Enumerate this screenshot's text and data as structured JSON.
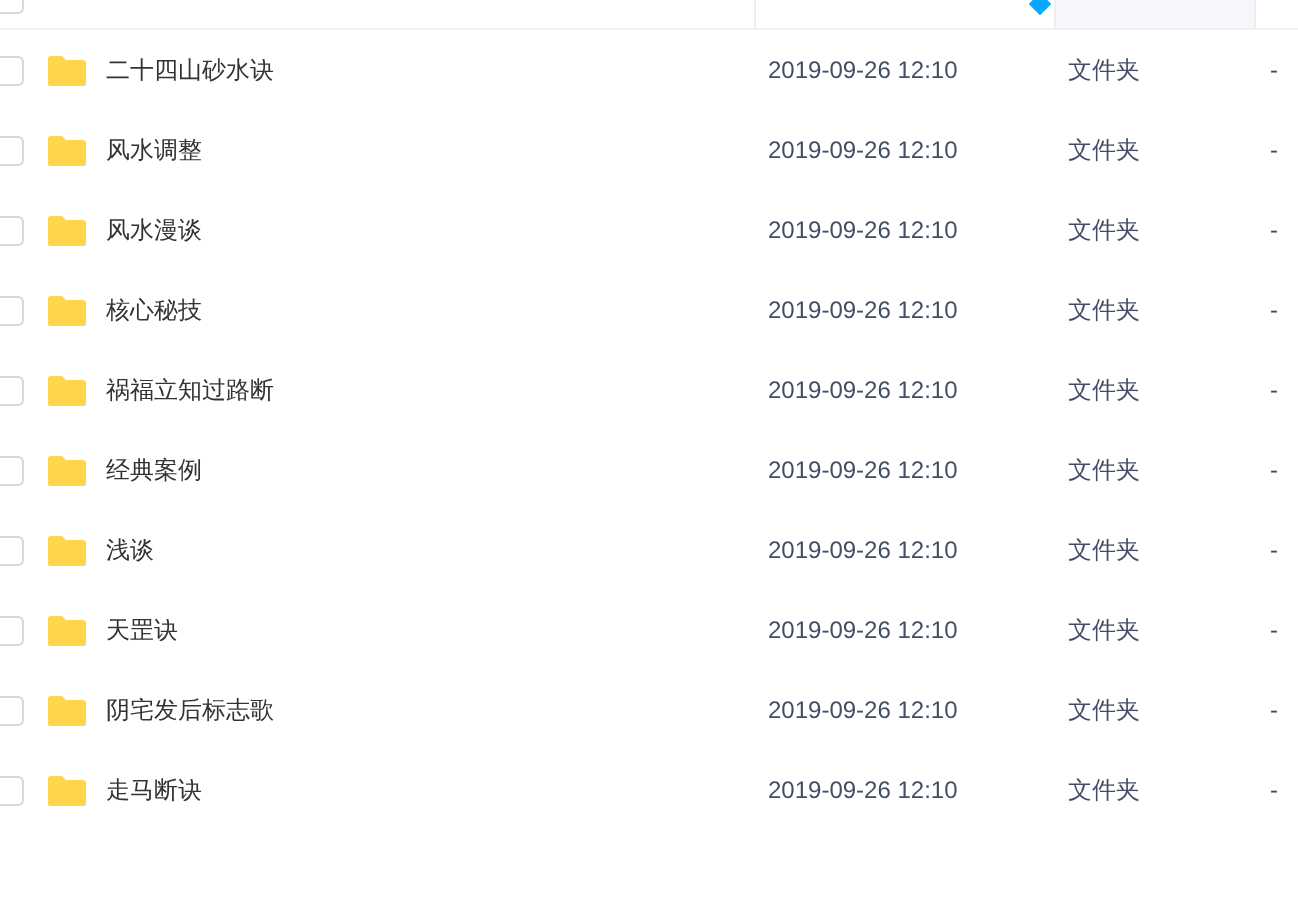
{
  "header": {
    "checked": false
  },
  "columns": [
    {
      "sorted": false
    },
    {
      "sorted": true
    },
    {
      "sorted": false
    },
    {
      "sorted": false
    }
  ],
  "rows": [
    {
      "name": "二十四山砂水诀",
      "modified": "2019-09-26 12:10",
      "type": "文件夹",
      "size": "-",
      "checked": false
    },
    {
      "name": "风水调整",
      "modified": "2019-09-26 12:10",
      "type": "文件夹",
      "size": "-",
      "checked": false
    },
    {
      "name": "风水漫谈",
      "modified": "2019-09-26 12:10",
      "type": "文件夹",
      "size": "-",
      "checked": false
    },
    {
      "name": "核心秘技",
      "modified": "2019-09-26 12:10",
      "type": "文件夹",
      "size": "-",
      "checked": false
    },
    {
      "name": "祸福立知过路断",
      "modified": "2019-09-26 12:10",
      "type": "文件夹",
      "size": "-",
      "checked": false
    },
    {
      "name": "经典案例",
      "modified": "2019-09-26 12:10",
      "type": "文件夹",
      "size": "-",
      "checked": false
    },
    {
      "name": "浅谈",
      "modified": "2019-09-26 12:10",
      "type": "文件夹",
      "size": "-",
      "checked": false
    },
    {
      "name": "天罡诀",
      "modified": "2019-09-26 12:10",
      "type": "文件夹",
      "size": "-",
      "checked": false
    },
    {
      "name": "阴宅发后标志歌",
      "modified": "2019-09-26 12:10",
      "type": "文件夹",
      "size": "-",
      "checked": false
    },
    {
      "name": "走马断诀",
      "modified": "2019-09-26 12:10",
      "type": "文件夹",
      "size": "-",
      "checked": false
    }
  ]
}
